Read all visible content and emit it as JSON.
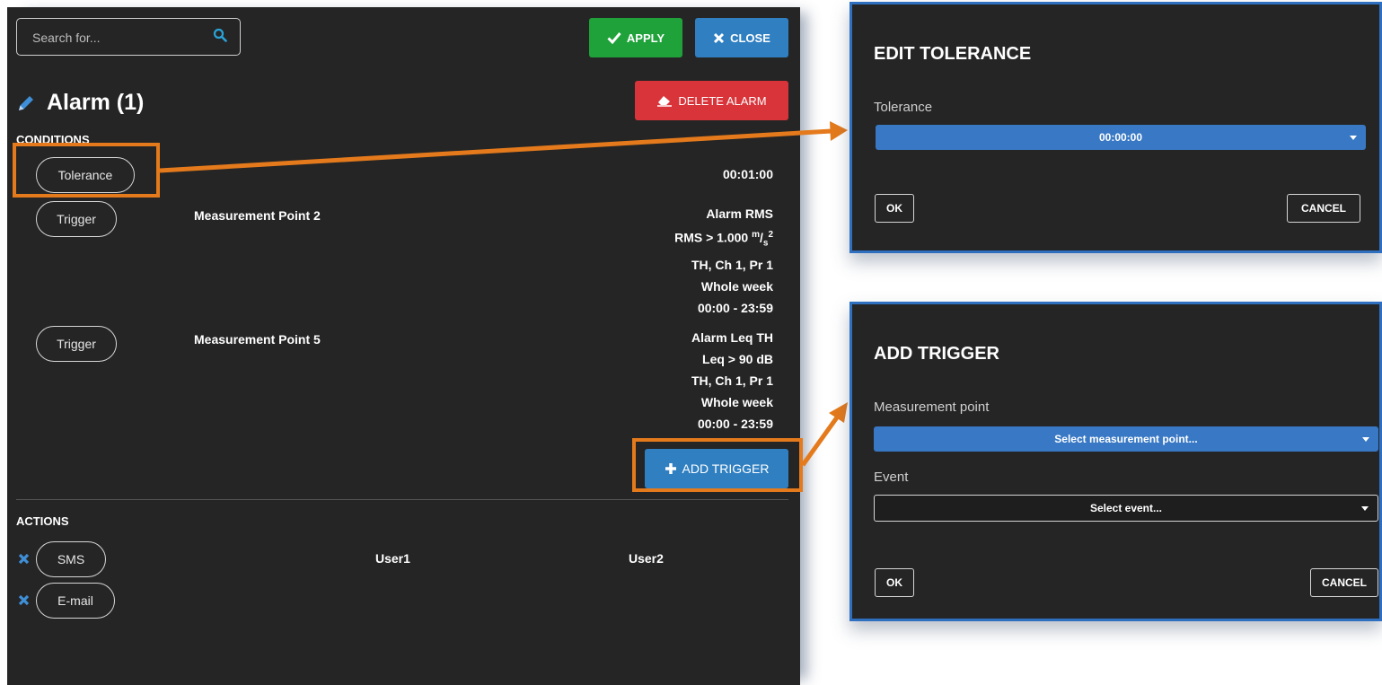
{
  "search": {
    "placeholder": "Search for..."
  },
  "toolbar": {
    "apply_label": "APPLY",
    "close_label": "CLOSE",
    "delete_label": "DELETE ALARM"
  },
  "title": "Alarm (1)",
  "conditions": {
    "heading": "CONDITIONS",
    "tolerance": {
      "label": "Tolerance",
      "value": "00:01:00"
    },
    "triggers": [
      {
        "label": "Trigger",
        "point": "Measurement Point 2",
        "details": [
          "Alarm RMS",
          "RMS > 1.000",
          "TH, Ch 1, Pr 1",
          "Whole week",
          "00:00 - 23:59"
        ],
        "unit_num": "m",
        "unit_den": "s",
        "unit_exp": "2"
      },
      {
        "label": "Trigger",
        "point": "Measurement Point 5",
        "details": [
          "Alarm Leq TH",
          "Leq > 90 dB",
          "TH, Ch 1, Pr 1",
          "Whole week",
          "00:00 - 23:59"
        ]
      }
    ],
    "add_trigger_label": "ADD TRIGGER"
  },
  "actions": {
    "heading": "ACTIONS",
    "items": [
      {
        "label": "SMS",
        "recipients": [
          "User1",
          "User2"
        ]
      },
      {
        "label": "E-mail",
        "recipients": []
      }
    ]
  },
  "edit_tolerance": {
    "title": "EDIT TOLERANCE",
    "field_label": "Tolerance",
    "value": "00:00:00",
    "ok": "OK",
    "cancel": "CANCEL"
  },
  "add_trigger": {
    "title": "ADD TRIGGER",
    "mp_label": "Measurement point",
    "mp_placeholder": "Select measurement point...",
    "event_label": "Event",
    "event_placeholder": "Select event...",
    "ok": "OK",
    "cancel": "CANCEL"
  },
  "colors": {
    "panel_bg": "#252525",
    "apply": "#1fa23a",
    "primary": "#2f7fc1",
    "danger": "#d9343a",
    "highlight": "#e47a1c"
  }
}
